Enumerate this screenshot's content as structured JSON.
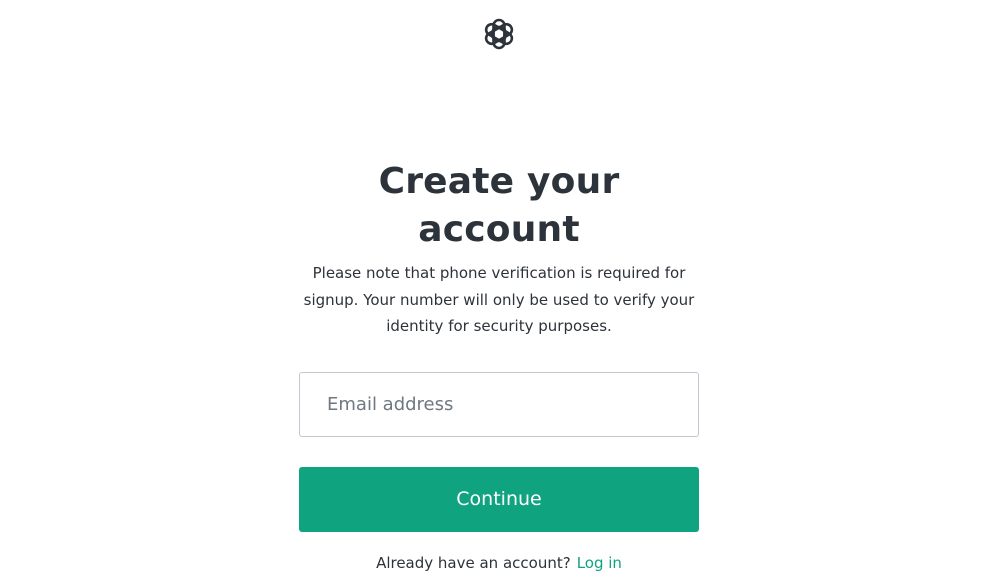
{
  "logo": {
    "icon": "openai-logo-icon"
  },
  "header": {
    "title": "Create your account",
    "subtitle": "Please note that phone verification is required for signup. Your number will only be used to verify your identity for security purposes."
  },
  "form": {
    "email_placeholder": "Email address",
    "email_value": "",
    "continue_label": "Continue"
  },
  "footer": {
    "prompt": "Already have an account?",
    "login_label": "Log in"
  },
  "colors": {
    "accent": "#10a37f",
    "text": "#2d333a",
    "input_border": "#c2c8d0"
  }
}
